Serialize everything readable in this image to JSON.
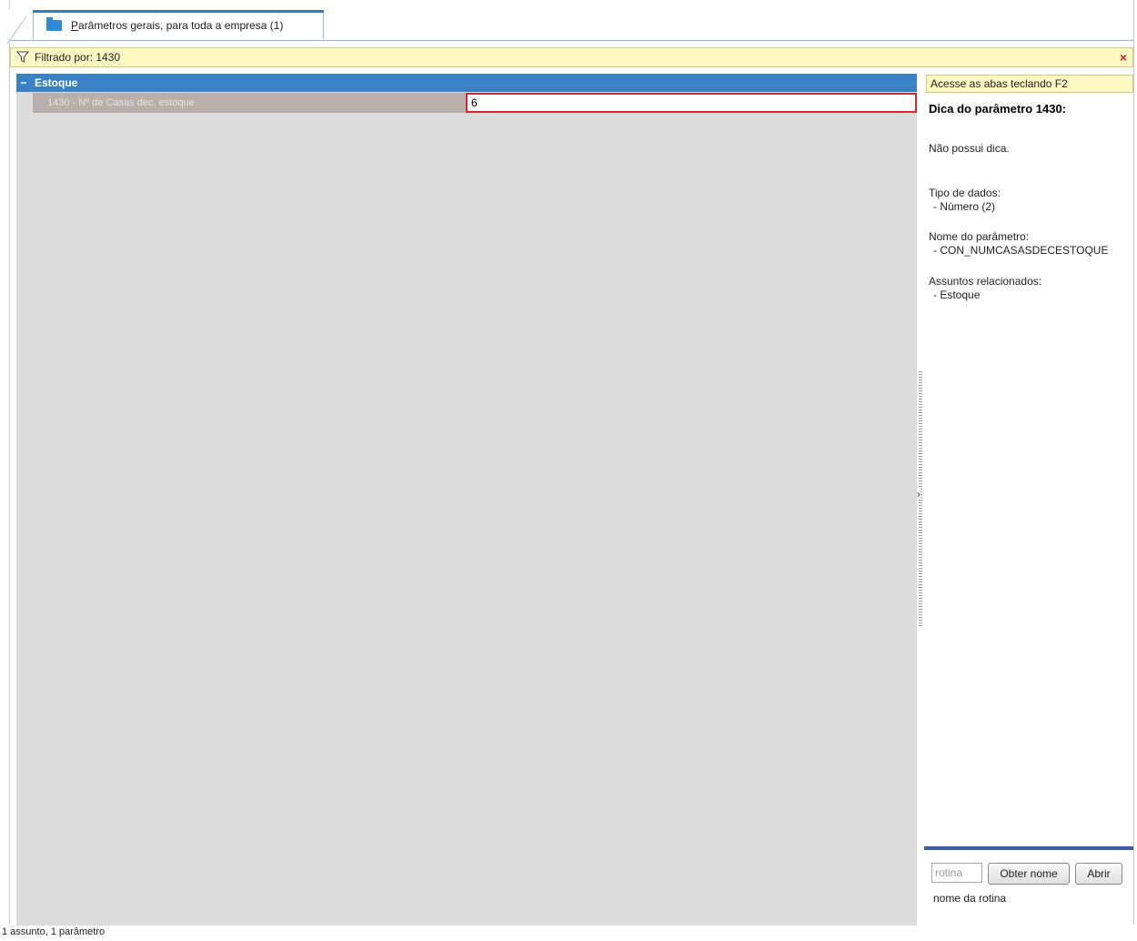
{
  "tab": {
    "label_accel": "P",
    "label_rest": "arâmetros gerais, para toda a empresa  (1)"
  },
  "filter": {
    "label": "Filtrado por: 1430",
    "close_glyph": "×"
  },
  "grid": {
    "group_toggle": "−",
    "group_label": "Estoque",
    "param_name": "1430 - Nº de Casas dec. estoque",
    "param_value": "6"
  },
  "splitter": {
    "arrow": "›"
  },
  "right_panel": {
    "hint": "Acesse as abas teclando F2",
    "title": "Dica do parâmetro 1430:",
    "no_tip": "Não possui dica.",
    "data_type_label": "Tipo de dados:",
    "data_type_value": "- Número (2)",
    "param_name_label": "Nome do parâmetro:",
    "param_name_value": "- CON_NUMCASASDECESTOQUE",
    "related_label": "Assuntos relacionados:",
    "related_value": "- Estoque"
  },
  "rotina": {
    "placeholder": "rotina",
    "obter_button": "Obter nome",
    "abrir_button": "Abrir",
    "name_text": "nome da rotina"
  },
  "status_bar": {
    "text": "1 assunto, 1 parâmetro"
  },
  "colors": {
    "accent": "#3b82c4",
    "highlight_border": "#d9272e",
    "info_bar": "#fff9c4"
  }
}
